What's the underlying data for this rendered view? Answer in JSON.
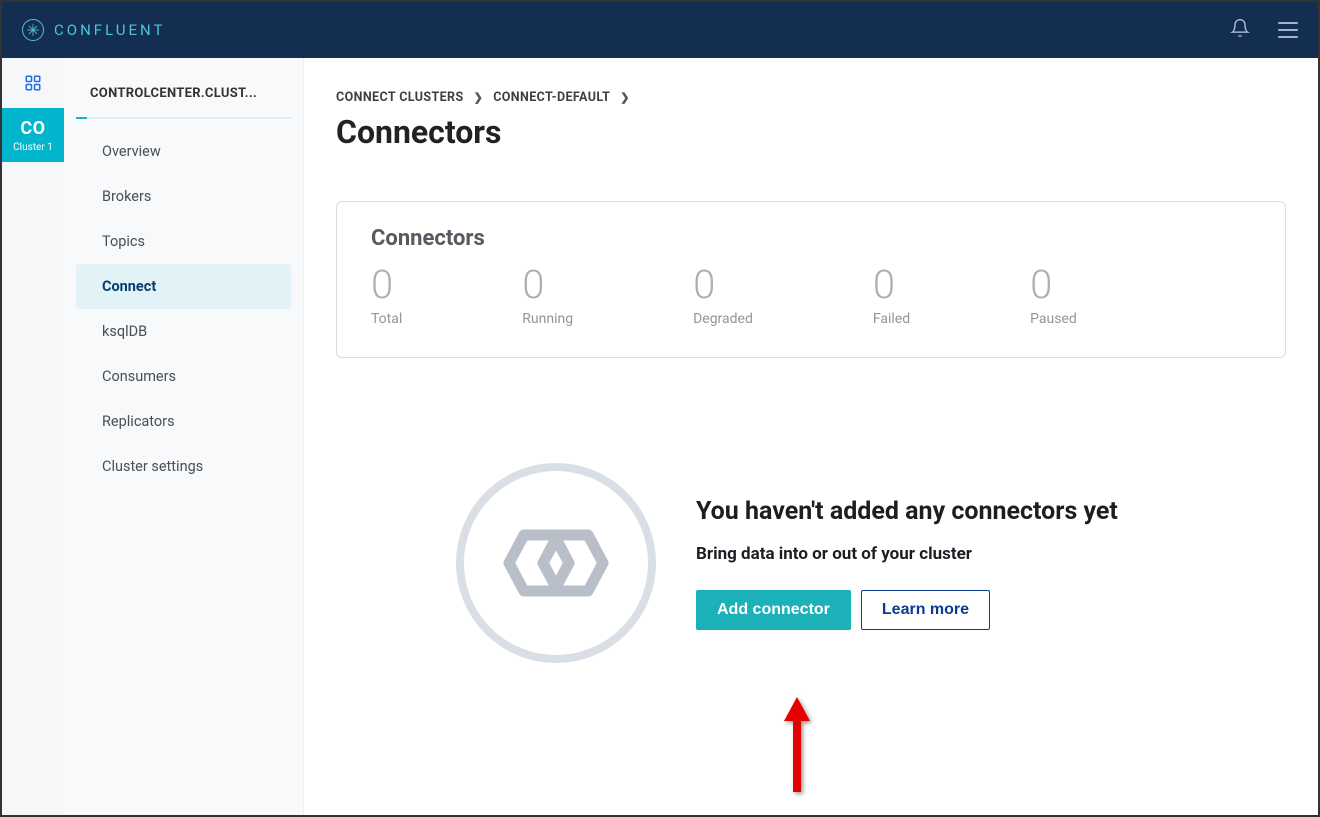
{
  "brand": "CONFLUENT",
  "rail": {
    "cluster_abbrev": "CO",
    "cluster_name": "Cluster 1"
  },
  "sidebar": {
    "title": "CONTROLCENTER.CLUST...",
    "items": [
      {
        "label": "Overview"
      },
      {
        "label": "Brokers"
      },
      {
        "label": "Topics"
      },
      {
        "label": "Connect"
      },
      {
        "label": "ksqlDB"
      },
      {
        "label": "Consumers"
      },
      {
        "label": "Replicators"
      },
      {
        "label": "Cluster settings"
      }
    ]
  },
  "breadcrumb": {
    "root": "CONNECT CLUSTERS",
    "current": "CONNECT-DEFAULT"
  },
  "page_title": "Connectors",
  "card": {
    "title": "Connectors",
    "stats": [
      {
        "value": "0",
        "label": "Total"
      },
      {
        "value": "0",
        "label": "Running"
      },
      {
        "value": "0",
        "label": "Degraded"
      },
      {
        "value": "0",
        "label": "Failed"
      },
      {
        "value": "0",
        "label": "Paused"
      }
    ]
  },
  "empty": {
    "heading": "You haven't added any connectors yet",
    "subheading": "Bring data into or out of your cluster",
    "primary_btn": "Add connector",
    "secondary_btn": "Learn more"
  }
}
